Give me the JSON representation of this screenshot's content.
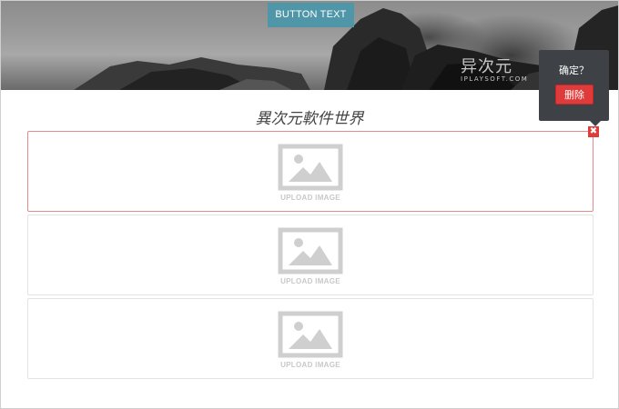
{
  "hero": {
    "button_label": "BUTTON TEXT",
    "watermark_cn": "异次元",
    "watermark_en": "IPLAYSOFT.COM"
  },
  "page": {
    "title": "異次元軟件世界"
  },
  "image_slots": [
    {
      "label": "UPLOAD IMAGE",
      "state": "selected"
    },
    {
      "label": "UPLOAD IMAGE",
      "state": "normal"
    },
    {
      "label": "UPLOAD IMAGE",
      "state": "normal"
    }
  ],
  "remove_control": {
    "glyph": "✖"
  },
  "popover": {
    "question": "确定？",
    "delete_label": "删除"
  },
  "colors": {
    "accent_button": "#4f96a8",
    "danger": "#e03b3b",
    "selected_border": "#e58b8b",
    "popover_bg": "#3e4146",
    "placeholder_icon": "#cfcfcf"
  }
}
